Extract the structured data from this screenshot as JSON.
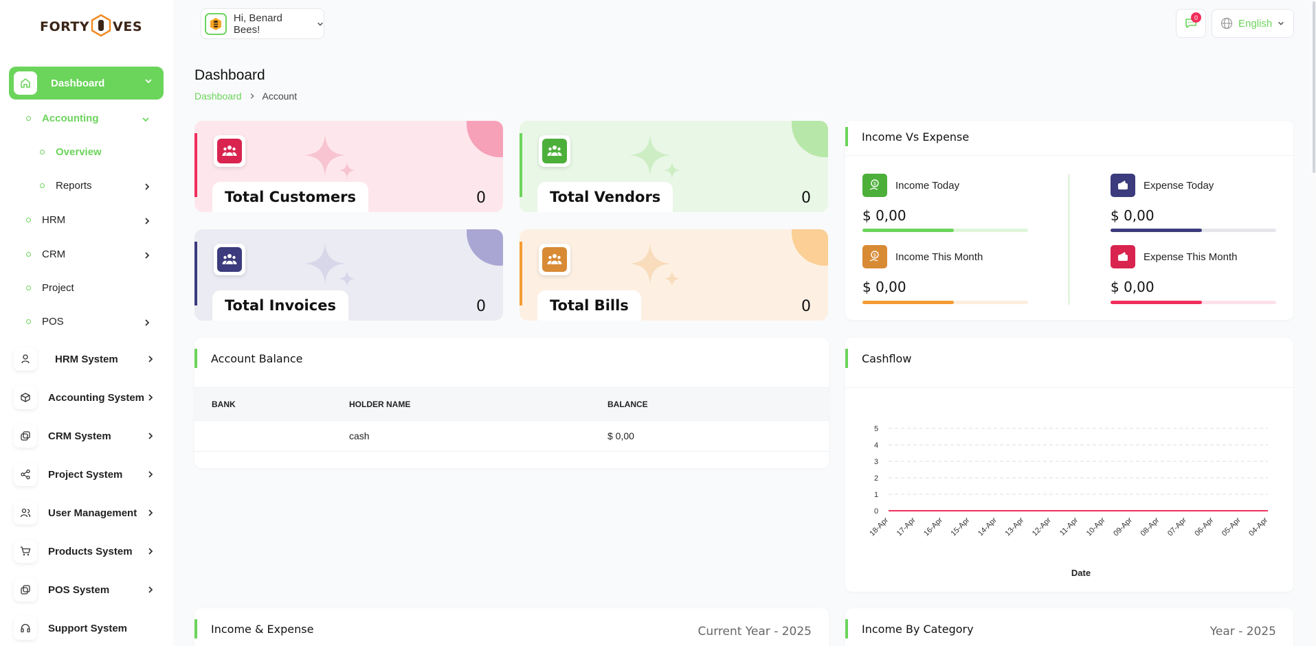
{
  "brand": {
    "part1": "FORTY",
    "part2": "H",
    "part3": "VES"
  },
  "header": {
    "greeting": "Hi, Benard Bees!",
    "notif_count": "0",
    "language": "English"
  },
  "page": {
    "title": "Dashboard",
    "breadcrumb": [
      "Dashboard",
      "Account"
    ]
  },
  "sidebar": {
    "active": {
      "label": "Dashboard",
      "icon": "home-icon"
    },
    "accounting": "Accounting",
    "overview": "Overview",
    "reports": "Reports",
    "hrm": "HRM",
    "crm": "CRM",
    "project": "Project",
    "pos": "POS",
    "systems": [
      {
        "label": "HRM System",
        "icon": "user-icon"
      },
      {
        "label": "Accounting System",
        "icon": "box-icon"
      },
      {
        "label": "CRM System",
        "icon": "copy-icon"
      },
      {
        "label": "Project System",
        "icon": "share-icon"
      },
      {
        "label": "User Management",
        "icon": "users-icon"
      },
      {
        "label": "Products System",
        "icon": "cart-icon"
      },
      {
        "label": "POS System",
        "icon": "copy-icon"
      },
      {
        "label": "Support System",
        "icon": "headset-icon"
      }
    ]
  },
  "stats": [
    {
      "label": "Total Customers",
      "value": "0",
      "color": "#d8244f"
    },
    {
      "label": "Total Vendors",
      "value": "0",
      "color": "#4caf3a"
    },
    {
      "label": "Total Invoices",
      "value": "0",
      "color": "#3b3b7d"
    },
    {
      "label": "Total Bills",
      "value": "0",
      "color": "#d88a35"
    }
  ],
  "income_expense": {
    "title": "Income Vs Expense",
    "items": [
      {
        "label": "Income Today",
        "value": "$ 0,00",
        "progress": 0.55
      },
      {
        "label": "Expense Today",
        "value": "$ 0,00",
        "progress": 0.55
      },
      {
        "label": "Income This Month",
        "value": "$ 0,00",
        "progress": 0.55
      },
      {
        "label": "Expense This Month",
        "value": "$ 0,00",
        "progress": 0.55
      }
    ]
  },
  "account_balance": {
    "title": "Account Balance",
    "columns": [
      "BANK",
      "HOLDER NAME",
      "BALANCE"
    ],
    "rows": [
      [
        "",
        "cash",
        "$ 0,00"
      ]
    ]
  },
  "cashflow": {
    "title": "Cashflow"
  },
  "chart_data": {
    "type": "line",
    "x": [
      "18-Apr",
      "17-Apr",
      "16-Apr",
      "15-Apr",
      "14-Apr",
      "13-Apr",
      "12-Apr",
      "11-Apr",
      "10-Apr",
      "09-Apr",
      "08-Apr",
      "07-Apr",
      "06-Apr",
      "05-Apr",
      "04-Apr"
    ],
    "series": [
      {
        "values": [
          0,
          0,
          0,
          0,
          0,
          0,
          0,
          0,
          0,
          0,
          0,
          0,
          0,
          0,
          0
        ]
      }
    ],
    "xlabel": "Date",
    "ylabel": "",
    "ylim": [
      0,
      5
    ],
    "yticks": [
      "0",
      "1",
      "2",
      "3",
      "4",
      "5"
    ],
    "grid": true,
    "line_color": "#ef2e5c"
  },
  "bottom": {
    "left_title": "Income & Expense",
    "left_sub": "Current Year - 2025",
    "right_title": "Income By Category",
    "right_sub": "Year - 2025"
  }
}
